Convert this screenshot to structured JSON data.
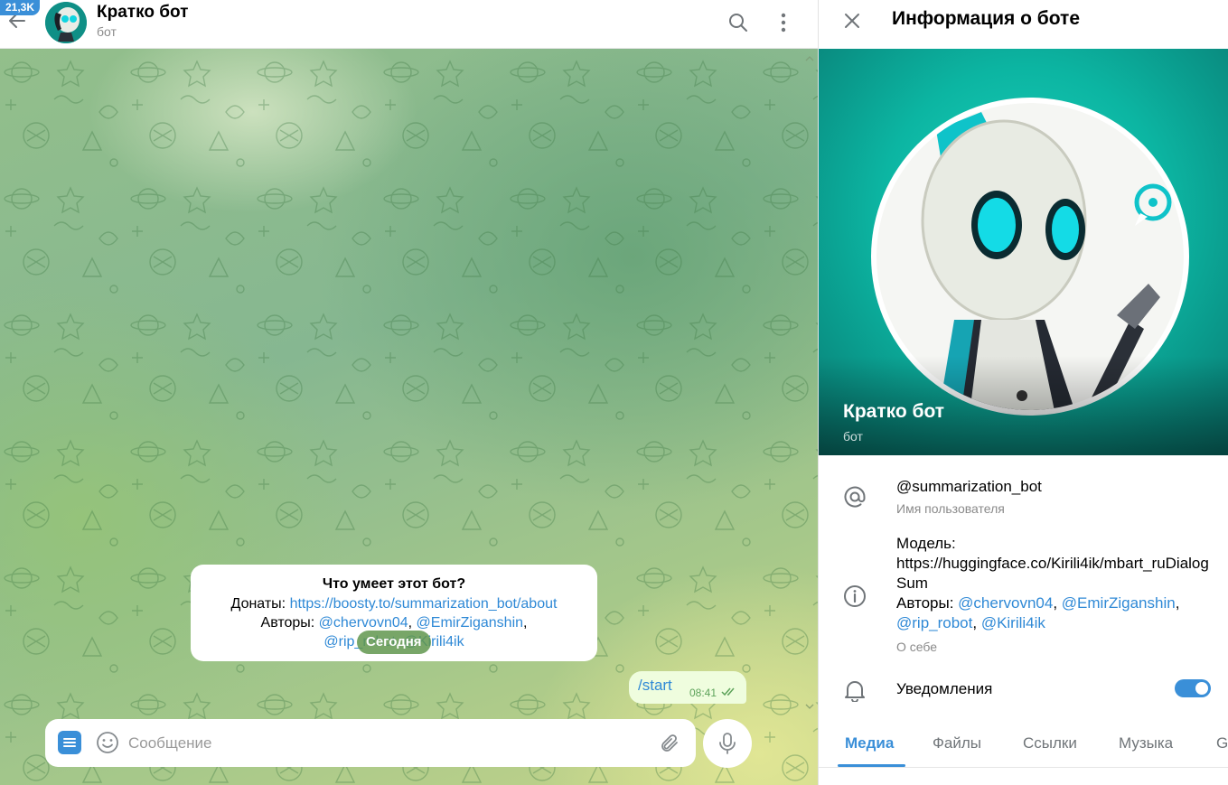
{
  "chat": {
    "badge": "21,3K",
    "title": "Кратко бот",
    "subtitle": "бот",
    "info_bubble": {
      "title": "Что умеет этот бот?",
      "donate_label": "Донаты: ",
      "donate_link": "https://boosty.to/summarization_bot/about",
      "authors_label": "Авторы: ",
      "author_1": "@chervovn04",
      "sep_1": ", ",
      "author_2": "@EmirZiganshin",
      "sep_2": ",",
      "author_3": "@rip_robot",
      "sep_3": ", ",
      "author_4": "@Kirili4ik"
    },
    "date_pill": "Сегодня",
    "outgoing": {
      "text": "/start",
      "time": "08:41"
    },
    "composer": {
      "placeholder": "Сообщение"
    }
  },
  "panel": {
    "title": "Информация о боте",
    "bot_name": "Кратко бот",
    "bot_sub": "бот",
    "username": {
      "value": "@summarization_bot",
      "label": "Имя пользователя"
    },
    "about": {
      "line_model": "Модель:",
      "line_url": "https://huggingface.co/Kirili4ik/mbart_ruDialogSum",
      "authors_label": "Авторы: ",
      "author_1": "@chervovn04",
      "sep_1": ", ",
      "author_2": "@EmirZiganshin",
      "sep_2": ",",
      "author_3": "@rip_robot",
      "sep_3": ", ",
      "author_4": "@Kirili4ik",
      "label": "О себе"
    },
    "notifications": {
      "label": "Уведомления",
      "enabled": true
    },
    "tabs": [
      "Медиа",
      "Файлы",
      "Ссылки",
      "Музыка",
      "G"
    ]
  },
  "colors": {
    "accent": "#3a8fd8",
    "link": "#2f89d6",
    "outgoing_bubble": "#effdde"
  }
}
